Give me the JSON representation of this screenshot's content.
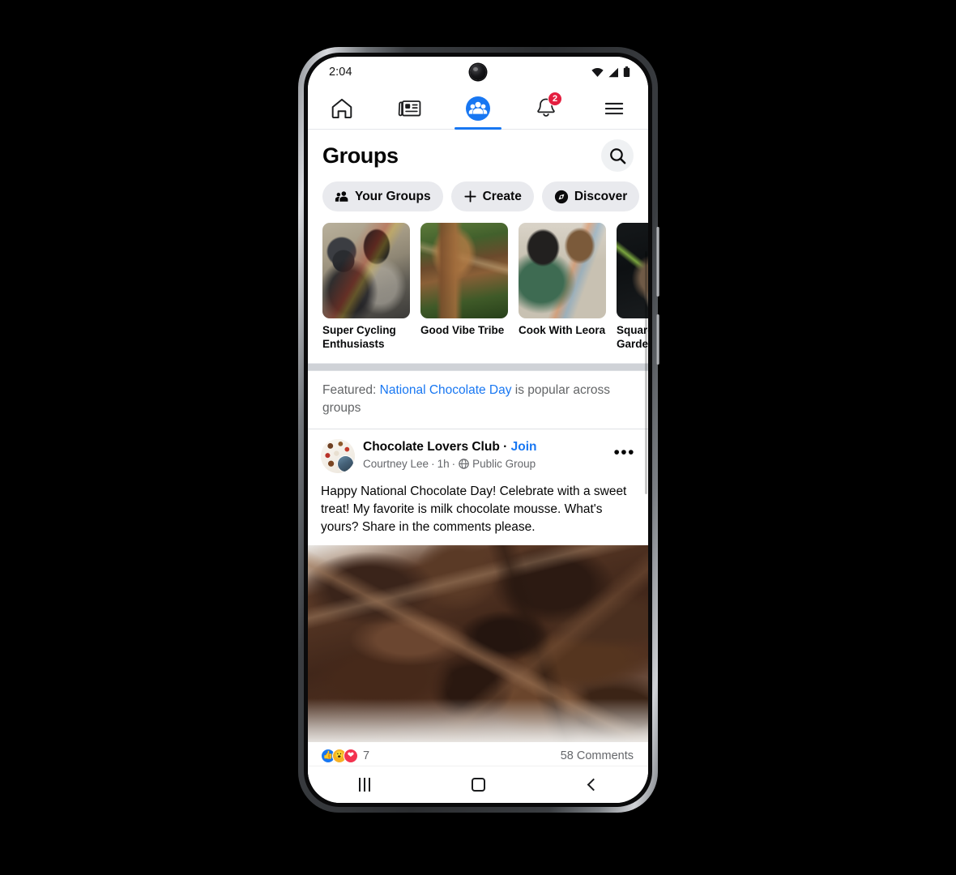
{
  "device": {
    "status_bar": {
      "time": "2:04",
      "icons": [
        "wifi-icon",
        "signal-icon",
        "battery-icon"
      ],
      "camera": "front-camera-dot"
    },
    "android_nav": {
      "recents_label": "recents-key",
      "home_label": "home-key",
      "back_label": "back-key"
    }
  },
  "nav_tabs": [
    {
      "name": "home",
      "icon": "home-icon",
      "active": false,
      "badge": null
    },
    {
      "name": "news",
      "icon": "news-feed-icon",
      "active": false,
      "badge": null
    },
    {
      "name": "groups",
      "icon": "groups-icon",
      "active": true,
      "badge": null
    },
    {
      "name": "notifications",
      "icon": "bell-icon",
      "active": false,
      "badge": "2"
    },
    {
      "name": "menu",
      "icon": "hamburger-menu-icon",
      "active": false,
      "badge": null
    }
  ],
  "header": {
    "title": "Groups",
    "search_icon": "search-icon"
  },
  "filter_pills": [
    {
      "label": "Your Groups",
      "icon": "people-icon"
    },
    {
      "label": "Create",
      "icon": "plus-icon"
    },
    {
      "label": "Discover",
      "icon": "compass-discover-icon"
    }
  ],
  "group_cards": [
    {
      "title": "Super Cycling Enthusiasts",
      "photo": "cyclists-in-helmets"
    },
    {
      "title": "Good Vibe Tribe",
      "photo": "treehouse-rope-bridge"
    },
    {
      "title": "Cook With Leora",
      "photo": "two-women-cooking"
    },
    {
      "title": "Square Foot Garden",
      "photo": "hands-holding-soil"
    }
  ],
  "featured": {
    "prefix": "Featured: ",
    "link": "National Chocolate Day",
    "suffix": " is popular across groups"
  },
  "post": {
    "group_name": "Chocolate Lovers Club",
    "separator": "·",
    "join_label": "Join",
    "author": "Courtney Lee",
    "time": "1h",
    "privacy": "Public Group",
    "privacy_icon": "globe-icon",
    "more_icon": "more-options-icon",
    "avatar": "chocolate-desserts-collage-avatar",
    "body": "Happy National Chocolate Day! Celebrate with a sweet treat! My favorite is milk chocolate mousse. What's yours? Share in the comments please.",
    "photo": "broken-dark-chocolate-chunks",
    "reactions": {
      "icons": [
        "like-reaction",
        "wow-reaction",
        "love-reaction"
      ],
      "count": "7"
    },
    "comments": "58 Comments"
  },
  "colors": {
    "accent_blue": "#1877f2",
    "badge_red": "#e41e3f",
    "pill_gray": "#e9eaee",
    "text_primary": "#050505",
    "text_secondary": "#65676b",
    "divider": "#cfd2d7"
  }
}
